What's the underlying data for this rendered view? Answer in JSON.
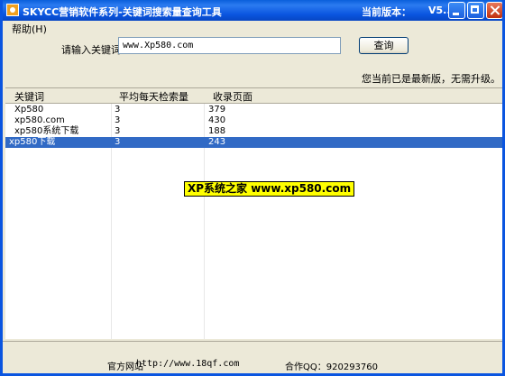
{
  "window": {
    "title": "SKYCC营销软件系列-关键词搜索量查询工具",
    "version_label": "当前版本：",
    "version_value": "V5..."
  },
  "menu": {
    "help": "帮助(H)"
  },
  "search": {
    "label": "请输入关键词",
    "value": "www.Xp580.com",
    "button": "查询"
  },
  "status": "您当前已是最新版，无需升级。",
  "table": {
    "columns": [
      "关键词",
      "平均每天检索量",
      "收录页面"
    ],
    "rows": [
      [
        "Xp580",
        "3",
        "379"
      ],
      [
        "xp580.com",
        "3",
        "430"
      ],
      [
        "xp580系统下载",
        "3",
        "188"
      ],
      [
        "xp580下载",
        "3",
        "243"
      ]
    ],
    "selected_index": 3
  },
  "watermark": "XP系统之家 www.xp580.com",
  "footer": {
    "site_label": "官方网站",
    "site_url": "http://www.18qf.com",
    "qq_label": "合作QQ：920293760"
  },
  "colors": {
    "titlebar": "#0a55e0",
    "selection": "#316ac5",
    "watermark_bg": "#ffff00"
  },
  "icons": [
    "app-icon",
    "minimize-icon",
    "maximize-icon",
    "close-icon"
  ]
}
